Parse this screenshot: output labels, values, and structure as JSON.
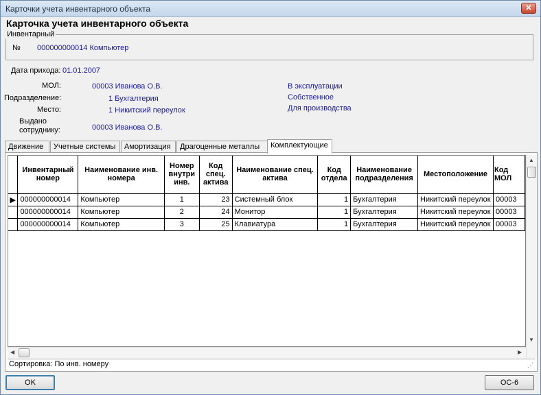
{
  "window": {
    "title": "Карточки учета инвентарного объекта",
    "close_glyph": "✕"
  },
  "heading": "Карточка учета инвентарного объекта",
  "inventory_group": {
    "legend": "Инвентарный",
    "number_label": "№",
    "number_value": "000000000014  Компьютер"
  },
  "fields": {
    "date_label": "Дата прихода:",
    "date_value": "01.01.2007",
    "mol_label": "МОЛ:",
    "mol_value": "00003 Иванова О.В.",
    "department_label": "Подразделение:",
    "department_value": "1 Бухгалтерия",
    "place_label": "Место:",
    "place_value": "1 Никитский переулок",
    "issued_label_1": "Выдано",
    "issued_label_2": "сотруднику:",
    "issued_value": "00003 Иванова О.В.",
    "status_1": "В эксплуатации",
    "status_2": "Собственное",
    "status_3": "Для производства"
  },
  "tabs": [
    {
      "label": "Движение"
    },
    {
      "label": "Учетные системы"
    },
    {
      "label": "Амортизация"
    },
    {
      "label": "Драгоценные металлы"
    },
    {
      "label": "Комплектующие"
    }
  ],
  "active_tab": "Комплектующие",
  "grid": {
    "columns": [
      "Инвентарный номер",
      "Наименование инв. номера",
      "Номер внутри инв.",
      "Код спец. актива",
      "Наименование спец. актива",
      "Код отдела",
      "Наименование подразделения",
      "Местоположение",
      "Код МОЛ"
    ],
    "rows": [
      [
        "000000000014",
        "Компьютер",
        "1",
        "23",
        "Системный блок",
        "1",
        "Бухгалтерия",
        "Никитский переулок",
        "00003"
      ],
      [
        "000000000014",
        "Компьютер",
        "2",
        "24",
        "Монитор",
        "1",
        "Бухгалтерия",
        "Никитский переулок",
        "00003"
      ],
      [
        "000000000014",
        "Компьютер",
        "3",
        "25",
        "Клавиатура",
        "1",
        "Бухгалтерия",
        "Никитский переулок",
        "00003"
      ]
    ],
    "current_row_marker": "▶"
  },
  "statusbar": {
    "text": "Сортировка: По инв. номеру"
  },
  "buttons": {
    "ok": "OK",
    "os6": "ОС-6"
  }
}
